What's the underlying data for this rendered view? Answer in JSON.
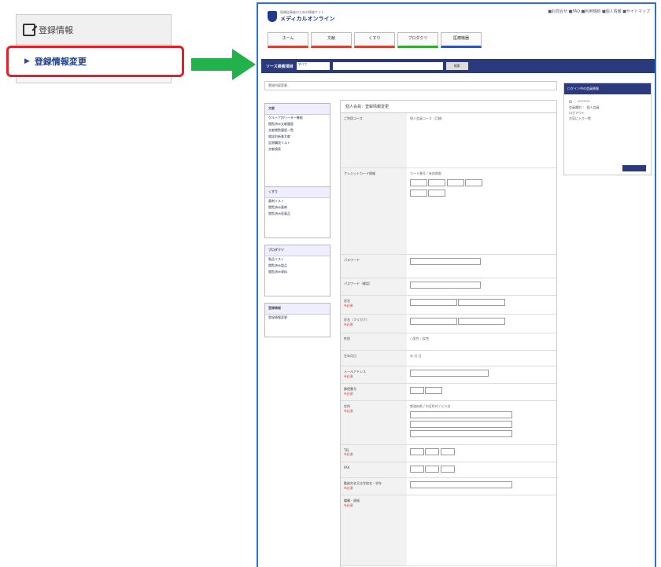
{
  "menu": {
    "header_label": "登録情報",
    "item_label": "登録情報変更",
    "item_marker": "▶"
  },
  "shot": {
    "brand_sub": "医療従事者のための情報サイト",
    "brand_name": "メディカルオンライン",
    "top_links": "■お問合せ  ■FAQ  ■利用規約  ■個人情報  ■サイトマップ",
    "nav_tabs": [
      "ホーム",
      "文献",
      "くすり",
      "プロダクツ",
      "医療機器"
    ],
    "search_label": "ソース検索項目",
    "search_select": "すべて",
    "search_button": "検索",
    "page_title": "登録内容変更",
    "form_title": "個人会員：登録情報変更",
    "sidebar_sections": [
      {
        "title": "文献",
        "items": [
          "グループ別リーダー機能",
          "閲覧済み文献履歴",
          "文献閲覧履歴一覧",
          "雑誌別新着文献",
          "定期購読リスト",
          "文献検索"
        ]
      },
      {
        "title": "くすり",
        "items": [
          "薬剤リスト",
          "閲覧済み薬剤",
          "閲覧済み医薬品"
        ]
      },
      {
        "title": "プロダクツ",
        "items": [
          "製品リスト",
          "閲覧済み製品",
          "閲覧済み資料"
        ]
      },
      {
        "title": "登録情報",
        "items": [
          "登録情報変更"
        ]
      }
    ],
    "form_rows": [
      {
        "label": "ご利用コース",
        "value": "個人会員コース（月額）",
        "req": ""
      },
      {
        "label": "クレジットカード情報",
        "value": "カード番号 / 有効期限",
        "req": ""
      },
      {
        "label": "パスワード",
        "value": "",
        "req": ""
      },
      {
        "label": "パスワード（確認）",
        "value": "",
        "req": ""
      },
      {
        "label": "氏名",
        "value": "",
        "req": "※必須"
      },
      {
        "label": "氏名（フリガナ）",
        "value": "",
        "req": "※必須"
      },
      {
        "label": "性別",
        "value": "○男性 ○女性",
        "req": ""
      },
      {
        "label": "生年月日",
        "value": "年 月 日",
        "req": ""
      },
      {
        "label": "メールアドレス",
        "value": "",
        "req": "※必須"
      },
      {
        "label": "郵便番号",
        "value": "",
        "req": "※必須"
      },
      {
        "label": "住所",
        "value": "都道府県 / 市区町村 / ビル名",
        "req": "※必須"
      },
      {
        "label": "TEL",
        "value": "",
        "req": "※必須"
      },
      {
        "label": "FAX",
        "value": "",
        "req": ""
      },
      {
        "label": "勤務先名又は学校名・学年",
        "value": "",
        "req": "※必須"
      },
      {
        "label": "職種・資格",
        "value": "",
        "req": "※必須"
      }
    ],
    "right_box_title": "ログイン中の会員情報",
    "right_box_lines": [
      "ID ： ********",
      "会員種別 ： 個人会員",
      "ログアウト",
      "お気に入り一覧"
    ]
  }
}
